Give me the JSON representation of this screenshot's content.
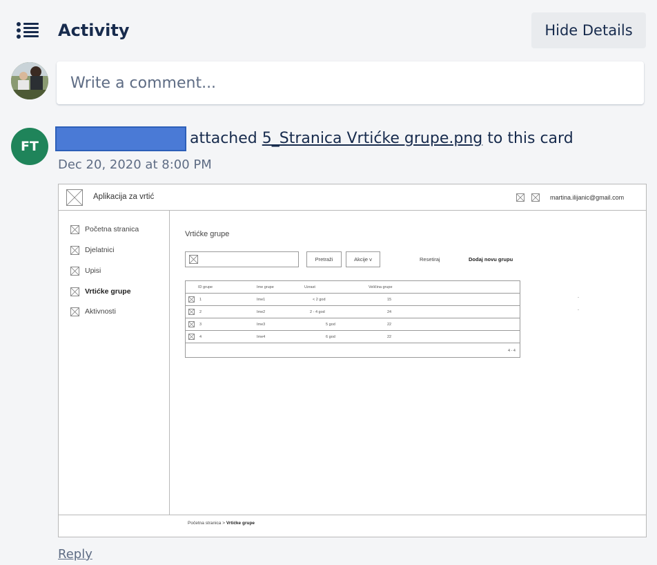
{
  "header": {
    "title": "Activity",
    "hide_details_label": "Hide Details",
    "icon": "activity-list-icon"
  },
  "comment": {
    "placeholder": "Write a comment..."
  },
  "activity": {
    "avatar_initials": "FT",
    "avatar_color": "#1f845a",
    "action_prefix": "attached",
    "attachment_name": "5_Stranica Vrtićke grupe.png",
    "action_suffix": "to this card",
    "date": "Dec 20, 2020 at 8:00 PM",
    "reply_label": "Reply"
  },
  "preview": {
    "app_name": "Aplikacija za vrtić",
    "email": "martina.ilijanic@gmail.com",
    "sidebar": [
      {
        "label": "Početna stranica",
        "active": false
      },
      {
        "label": "Djelatnici",
        "active": false
      },
      {
        "label": "Upisi",
        "active": false
      },
      {
        "label": "Vrtićke grupe",
        "active": true
      },
      {
        "label": "Aktivnosti",
        "active": false
      }
    ],
    "section_title": "Vrtićke grupe",
    "search_button": "Pretraži",
    "actions_button": "Akcije v",
    "reset_link": "Resetiraj",
    "add_link": "Dodaj novu grupu",
    "table": {
      "headers": [
        "ID grupe",
        "Ime grupe",
        "Uzrast",
        "Veličina grupe"
      ],
      "rows": [
        [
          "1",
          "Ime1",
          "< 2 god",
          "15"
        ],
        [
          "2",
          "Ime2",
          "2 - 4 god",
          "24"
        ],
        [
          "3",
          "Ime3",
          "5 god",
          "22"
        ],
        [
          "4",
          "Ime4",
          "6 god",
          "22"
        ]
      ],
      "pager": "4 - 4",
      "dash": "-"
    },
    "breadcrumb": {
      "home": "Početna stranica",
      "separator": ">",
      "current": "Vrtićke grupe"
    }
  }
}
